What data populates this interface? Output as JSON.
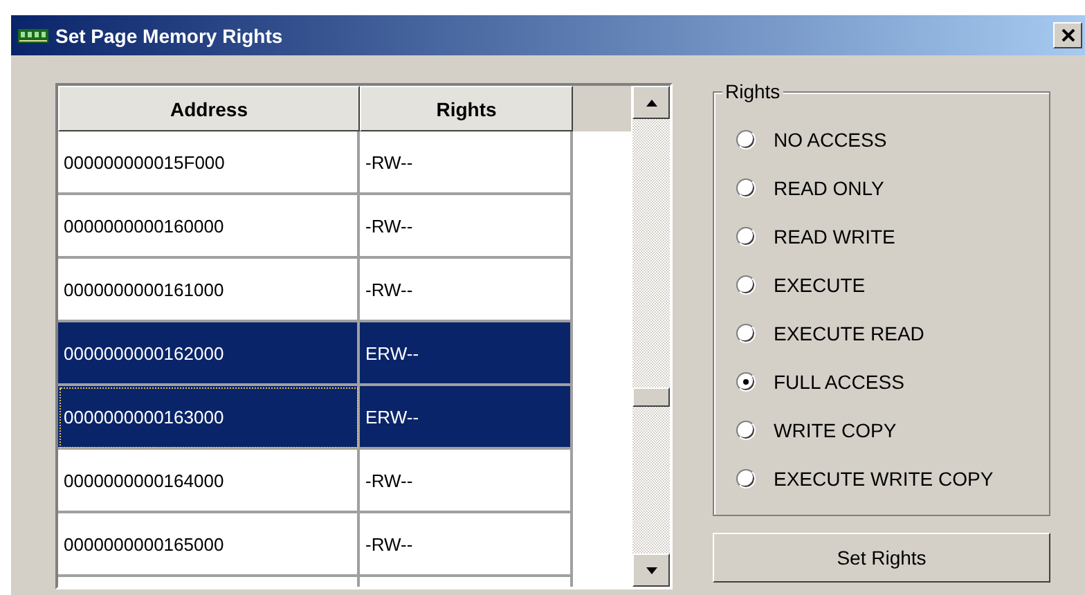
{
  "window": {
    "title": "Set Page Memory Rights"
  },
  "table": {
    "columns": [
      "Address",
      "Rights"
    ],
    "rows": [
      {
        "address": "000000000015F000",
        "rights": "-RW--",
        "selected": false,
        "focused": false
      },
      {
        "address": "0000000000160000",
        "rights": "-RW--",
        "selected": false,
        "focused": false
      },
      {
        "address": "0000000000161000",
        "rights": "-RW--",
        "selected": false,
        "focused": false
      },
      {
        "address": "0000000000162000",
        "rights": "ERW--",
        "selected": true,
        "focused": false
      },
      {
        "address": "0000000000163000",
        "rights": "ERW--",
        "selected": true,
        "focused": true
      },
      {
        "address": "0000000000164000",
        "rights": "-RW--",
        "selected": false,
        "focused": false
      },
      {
        "address": "0000000000165000",
        "rights": "-RW--",
        "selected": false,
        "focused": false
      }
    ]
  },
  "rights_group": {
    "title": "Rights",
    "options": [
      {
        "label": "NO ACCESS",
        "selected": false
      },
      {
        "label": "READ ONLY",
        "selected": false
      },
      {
        "label": "READ WRITE",
        "selected": false
      },
      {
        "label": "EXECUTE",
        "selected": false
      },
      {
        "label": "EXECUTE READ",
        "selected": false
      },
      {
        "label": "FULL ACCESS",
        "selected": true
      },
      {
        "label": "WRITE COPY",
        "selected": false
      },
      {
        "label": "EXECUTE WRITE COPY",
        "selected": false
      }
    ]
  },
  "buttons": [
    "Set Rights"
  ]
}
